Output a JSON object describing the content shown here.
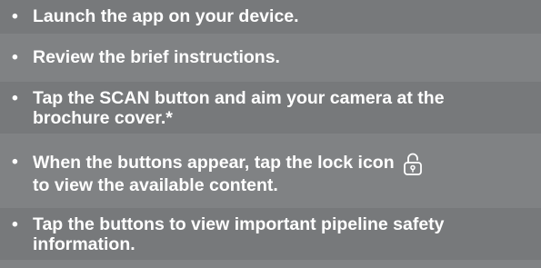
{
  "bullet": "•",
  "steps": [
    {
      "lines": [
        "Launch the app on your device."
      ]
    },
    {
      "lines": [
        "Review the brief instructions."
      ]
    },
    {
      "lines": [
        "Tap the SCAN button and aim your camera at the",
        "brochure cover.*"
      ]
    },
    {
      "lines": [
        "When the buttons appear, tap the lock icon",
        "to view the available content."
      ],
      "icon": "unlocked-padlock-icon"
    },
    {
      "lines": [
        "Tap the buttons to view important pipeline safety",
        "information."
      ]
    }
  ]
}
